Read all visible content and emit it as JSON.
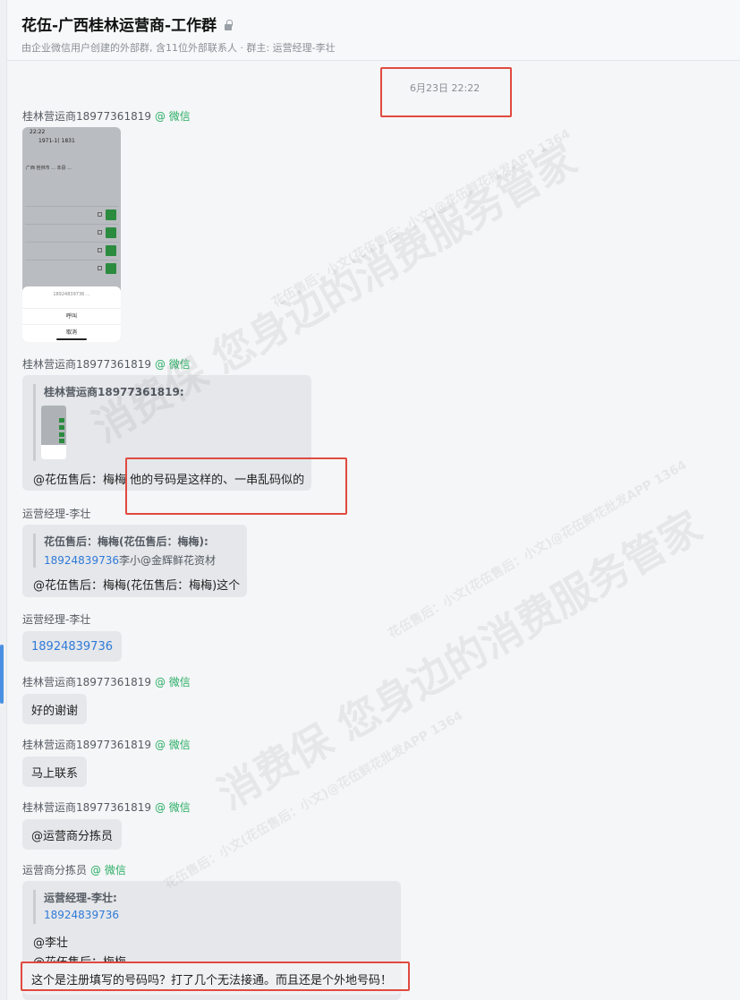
{
  "header": {
    "title": "花伍-广西桂林运营商-工作群",
    "subtitle": "由企业微信用户创建的外部群, 含11位外部联系人 · 群主: 运营经理-李壮"
  },
  "date_divider": "6月23日 22:22",
  "wechat_tag": "@ 微信",
  "messages": {
    "m1": {
      "sender": "桂林营运商18977361819"
    },
    "phone": {
      "status": "22:22",
      "head": "1971-1( 1831",
      "title": "广西 桂林市 ... 本县 ...",
      "sheet_line1": "18924839736 ...",
      "sheet_action": "呼叫",
      "sheet_cancel": "取消"
    },
    "m2": {
      "sender": "桂林营运商18977361819",
      "quote_name": "桂林营运商18977361819:",
      "text": "@花伍售后：梅梅 他的号码是这样的、一串乱码似的"
    },
    "m3": {
      "sender": "运营经理-李壮",
      "quote_name": "花伍售后：梅梅(花伍售后：梅梅):",
      "quote_link": "18924839736",
      "quote_rest": "李小@金辉鲜花资材",
      "text": "@花伍售后：梅梅(花伍售后：梅梅)这个"
    },
    "m4": {
      "sender": "运营经理-李壮",
      "text": "18924839736"
    },
    "m5": {
      "sender": "桂林营运商18977361819",
      "text": "好的谢谢"
    },
    "m6": {
      "sender": "桂林营运商18977361819",
      "text": "马上联系"
    },
    "m7": {
      "sender": "桂林营运商18977361819",
      "text": "@运营商分拣员"
    },
    "m8": {
      "sender": "运营商分拣员",
      "quote_name": "运营经理-李壮:",
      "quote_link": "18924839736",
      "line1": "@李壮",
      "line2": "@花伍售后：梅梅",
      "line3": "这个是注册填写的号码吗？打了几个无法接通。而且还是个外地号码！"
    }
  },
  "watermark": {
    "big": "消费保 您身边的消费服务管家",
    "small": "花伍售后：小文(花伍售后：小文)@花伍鲜花批发APP 1364"
  },
  "colors": {
    "accent": "#2f7ad8",
    "wechat_green": "#2aae67",
    "highlight": "#e04a3f"
  }
}
